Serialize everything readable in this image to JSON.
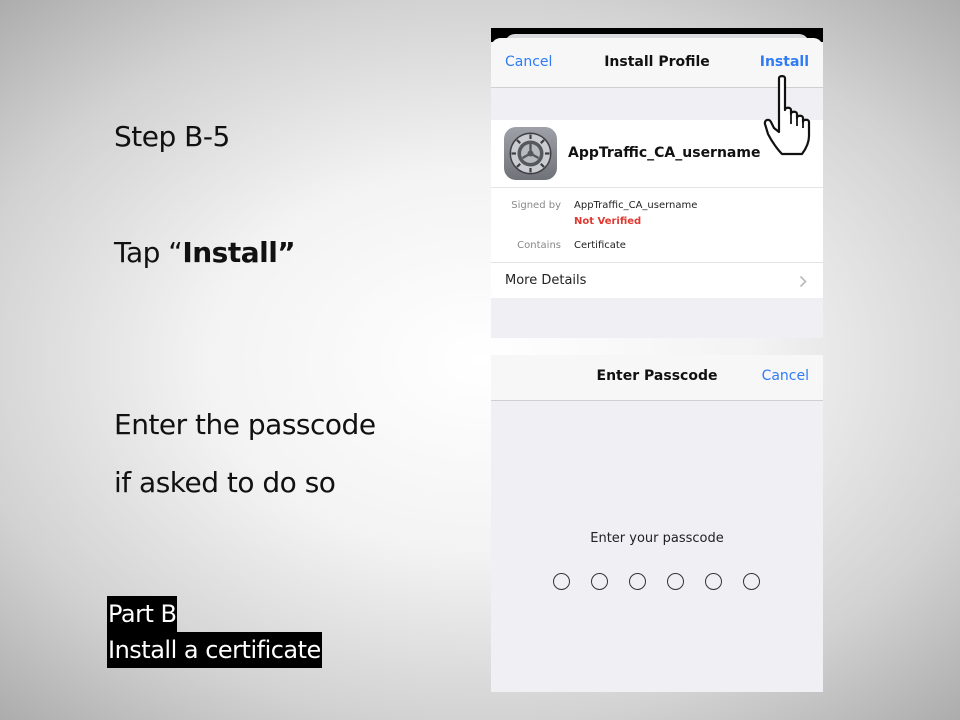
{
  "slide": {
    "step": "Step B-5",
    "tap_prefix": "Tap “",
    "tap_bold": "Install”",
    "passcode_line1": "Enter the passcode",
    "passcode_line2": "if asked to do so",
    "part_line1": "Part B",
    "part_line2": "Install a certificate"
  },
  "install_profile": {
    "cancel_label": "Cancel",
    "title": "Install Profile",
    "install_label": "Install",
    "profile_name": "AppTraffic_CA_username",
    "signed_by_label": "Signed by",
    "signed_by_value": "AppTraffic_CA_username",
    "verification_status": "Not Verified",
    "contains_label": "Contains",
    "contains_value": "Certificate",
    "more_details_label": "More Details"
  },
  "enter_passcode": {
    "title": "Enter Passcode",
    "cancel_label": "Cancel",
    "prompt": "Enter your passcode",
    "digit_count": 6,
    "digits_entered": 0
  },
  "colors": {
    "link_blue": "#2f7cf6",
    "warning_red": "#e0392f",
    "ios_background": "#efeff4"
  },
  "icons": [
    "settings-gear-icon",
    "chevron-right-icon",
    "pointing-hand-icon"
  ]
}
